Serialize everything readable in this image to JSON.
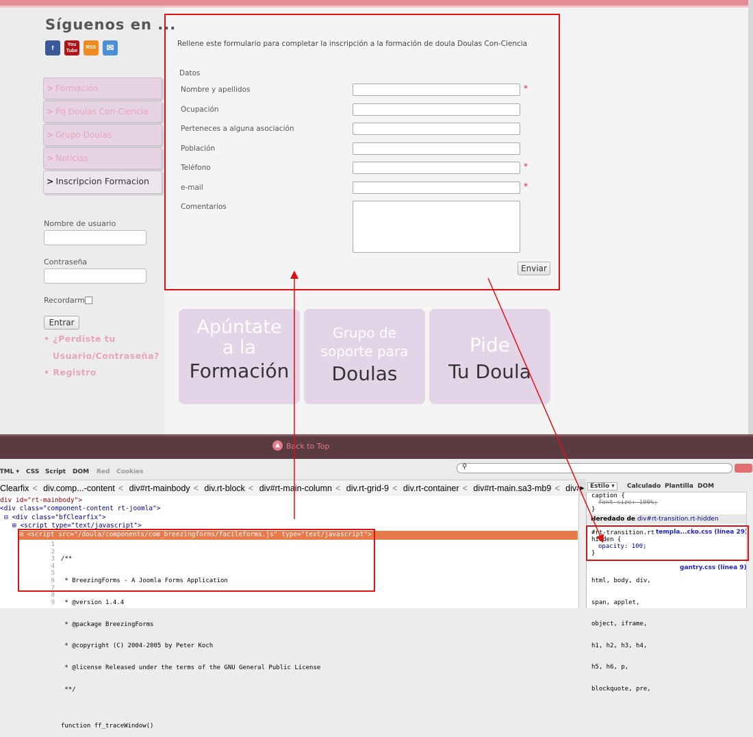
{
  "sidebar": {
    "follow_title": "Síguenos en ...",
    "social": [
      "f",
      "You Tube",
      "RSS",
      "✉"
    ],
    "menu": [
      {
        "label": "Formación"
      },
      {
        "label": "Pq Doulas Con-Ciencia"
      },
      {
        "label": "Grupo Doulas"
      },
      {
        "label": "Noticias"
      },
      {
        "label": "Inscripcion Formacion"
      }
    ],
    "chevron": ">",
    "username_label": "Nombre de usuario",
    "password_label": "Contraseña",
    "remember_label": "Recordarme",
    "login_button": "Entrar",
    "forgot_line1": "¿Perdiste tu",
    "forgot_line2": "Usuario/Contraseña?",
    "register": "Registro",
    "bullet": "•"
  },
  "form": {
    "intro": "Rellene este formulario para completar la inscripción a la formación de doula Doulas Con-Ciencia",
    "section": "Datos",
    "fields": [
      {
        "label": "Nombre y apellidos",
        "required": true
      },
      {
        "label": "Ocupación",
        "required": false
      },
      {
        "label": "Perteneces a alguna asociación",
        "required": false
      },
      {
        "label": "Población",
        "required": false
      },
      {
        "label": "Teléfono",
        "required": true
      },
      {
        "label": "e-mail",
        "required": true
      },
      {
        "label": "Comentarios",
        "required": false
      }
    ],
    "required_mark": "*",
    "submit": "Enviar"
  },
  "cards": [
    {
      "l1": "Apúntate",
      "l2": "a la",
      "l3": "Formación"
    },
    {
      "l1": "Grupo de",
      "l2": "soporte para",
      "l3": "Doulas"
    },
    {
      "l1": "Pide",
      "l2": "",
      "l3": "Tu Doula"
    }
  ],
  "footer": {
    "back_to_top": "Back to Top"
  },
  "devtools": {
    "tabs": [
      "HTML ▾",
      "CSS",
      "Script",
      "DOM",
      "Red",
      "Cookies"
    ],
    "breadcrumbs": [
      "Clearfix",
      "div.comp...-content",
      "div#rt-mainbody",
      "div.rt-block",
      "div#rt-main-column",
      "div.rt-grid-9",
      "div.rt-container",
      "div#rt-main.sa3-mb9",
      "div#rt-bo"
    ],
    "html_lines": [
      "div id=\"rt-mainbody\">",
      "<div class=\"component-content rt-joomla\">",
      "⊟ <div class=\"bfClearfix\">",
      "⊞ <script type=\"text/javascript\">",
      "⊟ <script src=\"/doula/components/com_breezingforms/facileforms.js\" type=\"text/javascript\">"
    ],
    "code": [
      {
        "n": "1",
        "t": "/**"
      },
      {
        "n": "2",
        "t": " * BreezingForms - A Joomla Forms Application"
      },
      {
        "n": "3",
        "t": " * @version 1.4.4"
      },
      {
        "n": "4",
        "t": " * @package BreezingForms"
      },
      {
        "n": "5",
        "t": " * @copyright (C) 2004-2005 by Peter Koch"
      },
      {
        "n": "6",
        "t": " * @license Released under the terms of the GNU General Public License"
      },
      {
        "n": "7",
        "t": " **/"
      },
      {
        "n": "8",
        "t": ""
      },
      {
        "n": "9",
        "t": "function ff_traceWindow()"
      }
    ],
    "style_tabs": [
      "Estilo ▾",
      "Calculado",
      "Plantilla",
      "DOM"
    ],
    "css": {
      "caption": "caption {",
      "font_size": "font-size: 100%;",
      "close": "}",
      "inherited_label": "Heredado de",
      "inherited_from": "div#rt-transition.rt-hidden",
      "rule1_sel_a": "#rt-transition.rt",
      "rule1_sel_b": "hidden {",
      "rule1_link": "templa...cko.css (línea 29)",
      "rule1_prop": "opacity: 100;",
      "rule2_sel": [
        "html, body, div,",
        "span, applet,",
        "object, iframe,",
        "h1, h2, h3, h4,",
        "h5, h6, p,",
        "blockquote, pre,"
      ],
      "rule2_link": "gantry.css (línea 9)"
    }
  },
  "colors": {
    "accent_pink": "#e8a4bc",
    "annotation_red": "#e01010",
    "footer": "#5a3b42",
    "card_bg": "#e4d4e7"
  }
}
